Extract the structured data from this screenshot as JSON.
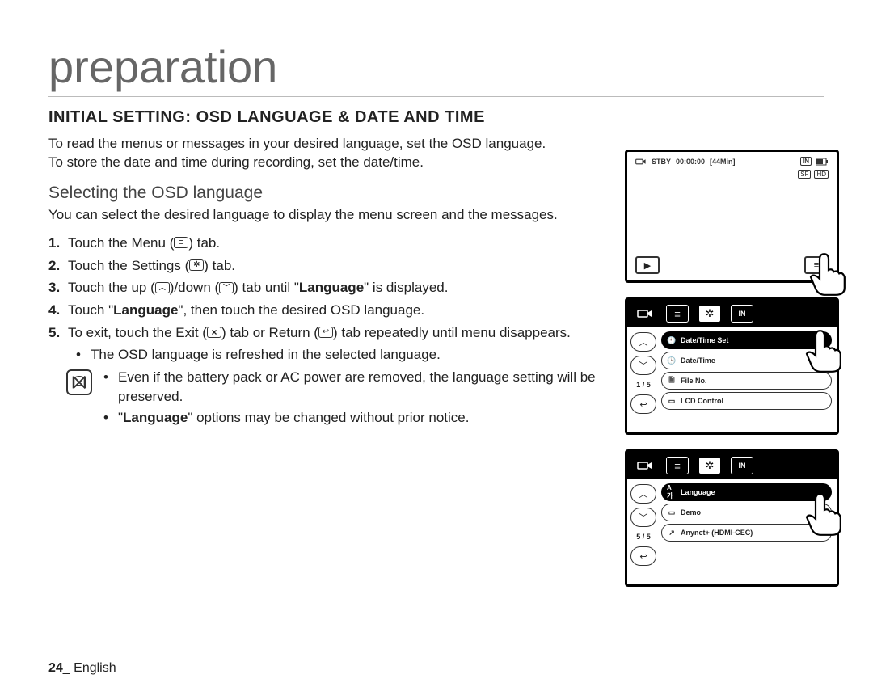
{
  "page": {
    "chapter": "preparation",
    "section": "INITIAL SETTING: OSD LANGUAGE & DATE AND TIME",
    "intro1": "To read the menus or messages in your desired language, set the OSD language.",
    "intro2": "To store the date and time during recording, set the date/time.",
    "subhead": "Selecting the OSD language",
    "subpara": "You can select the desired language to display the menu screen and the messages.",
    "steps": {
      "s1_a": "Touch the Menu (",
      "s1_b": ") tab.",
      "s2_a": "Touch the Settings (",
      "s2_b": ") tab.",
      "s3_a": "Touch the up (",
      "s3_b": ")/down (",
      "s3_c": ") tab until \"",
      "s3_d": "Language",
      "s3_e": "\" is displayed.",
      "s4_a": "Touch \"",
      "s4_b": "Language",
      "s4_c": "\", then touch the desired OSD language.",
      "s5_a": "To exit, touch the Exit (",
      "s5_b": ") tab or Return (",
      "s5_c": ") tab repeatedly until menu disappears.",
      "s5_bullet": "The OSD language is refreshed in the selected language."
    },
    "notes": {
      "n1": "Even if the battery pack or AC power are removed, the language setting will be preserved.",
      "n2_a": "\"",
      "n2_b": "Language",
      "n2_c": "\" options may be changed without prior notice."
    },
    "footer_num": "24",
    "footer_lang": "_ English"
  },
  "screens": {
    "a": {
      "mode": "STBY",
      "time": "00:00:00",
      "remain": "[44Min]",
      "storage": "IN",
      "quality1": "SF",
      "quality2": "HD"
    },
    "b": {
      "page": "1 / 5",
      "items": [
        "Date/Time Set",
        "Date/Time",
        "File No.",
        "LCD Control"
      ]
    },
    "c": {
      "page": "5 / 5",
      "items": [
        "Language",
        "Demo",
        "Anynet+ (HDMI-CEC)"
      ]
    }
  }
}
